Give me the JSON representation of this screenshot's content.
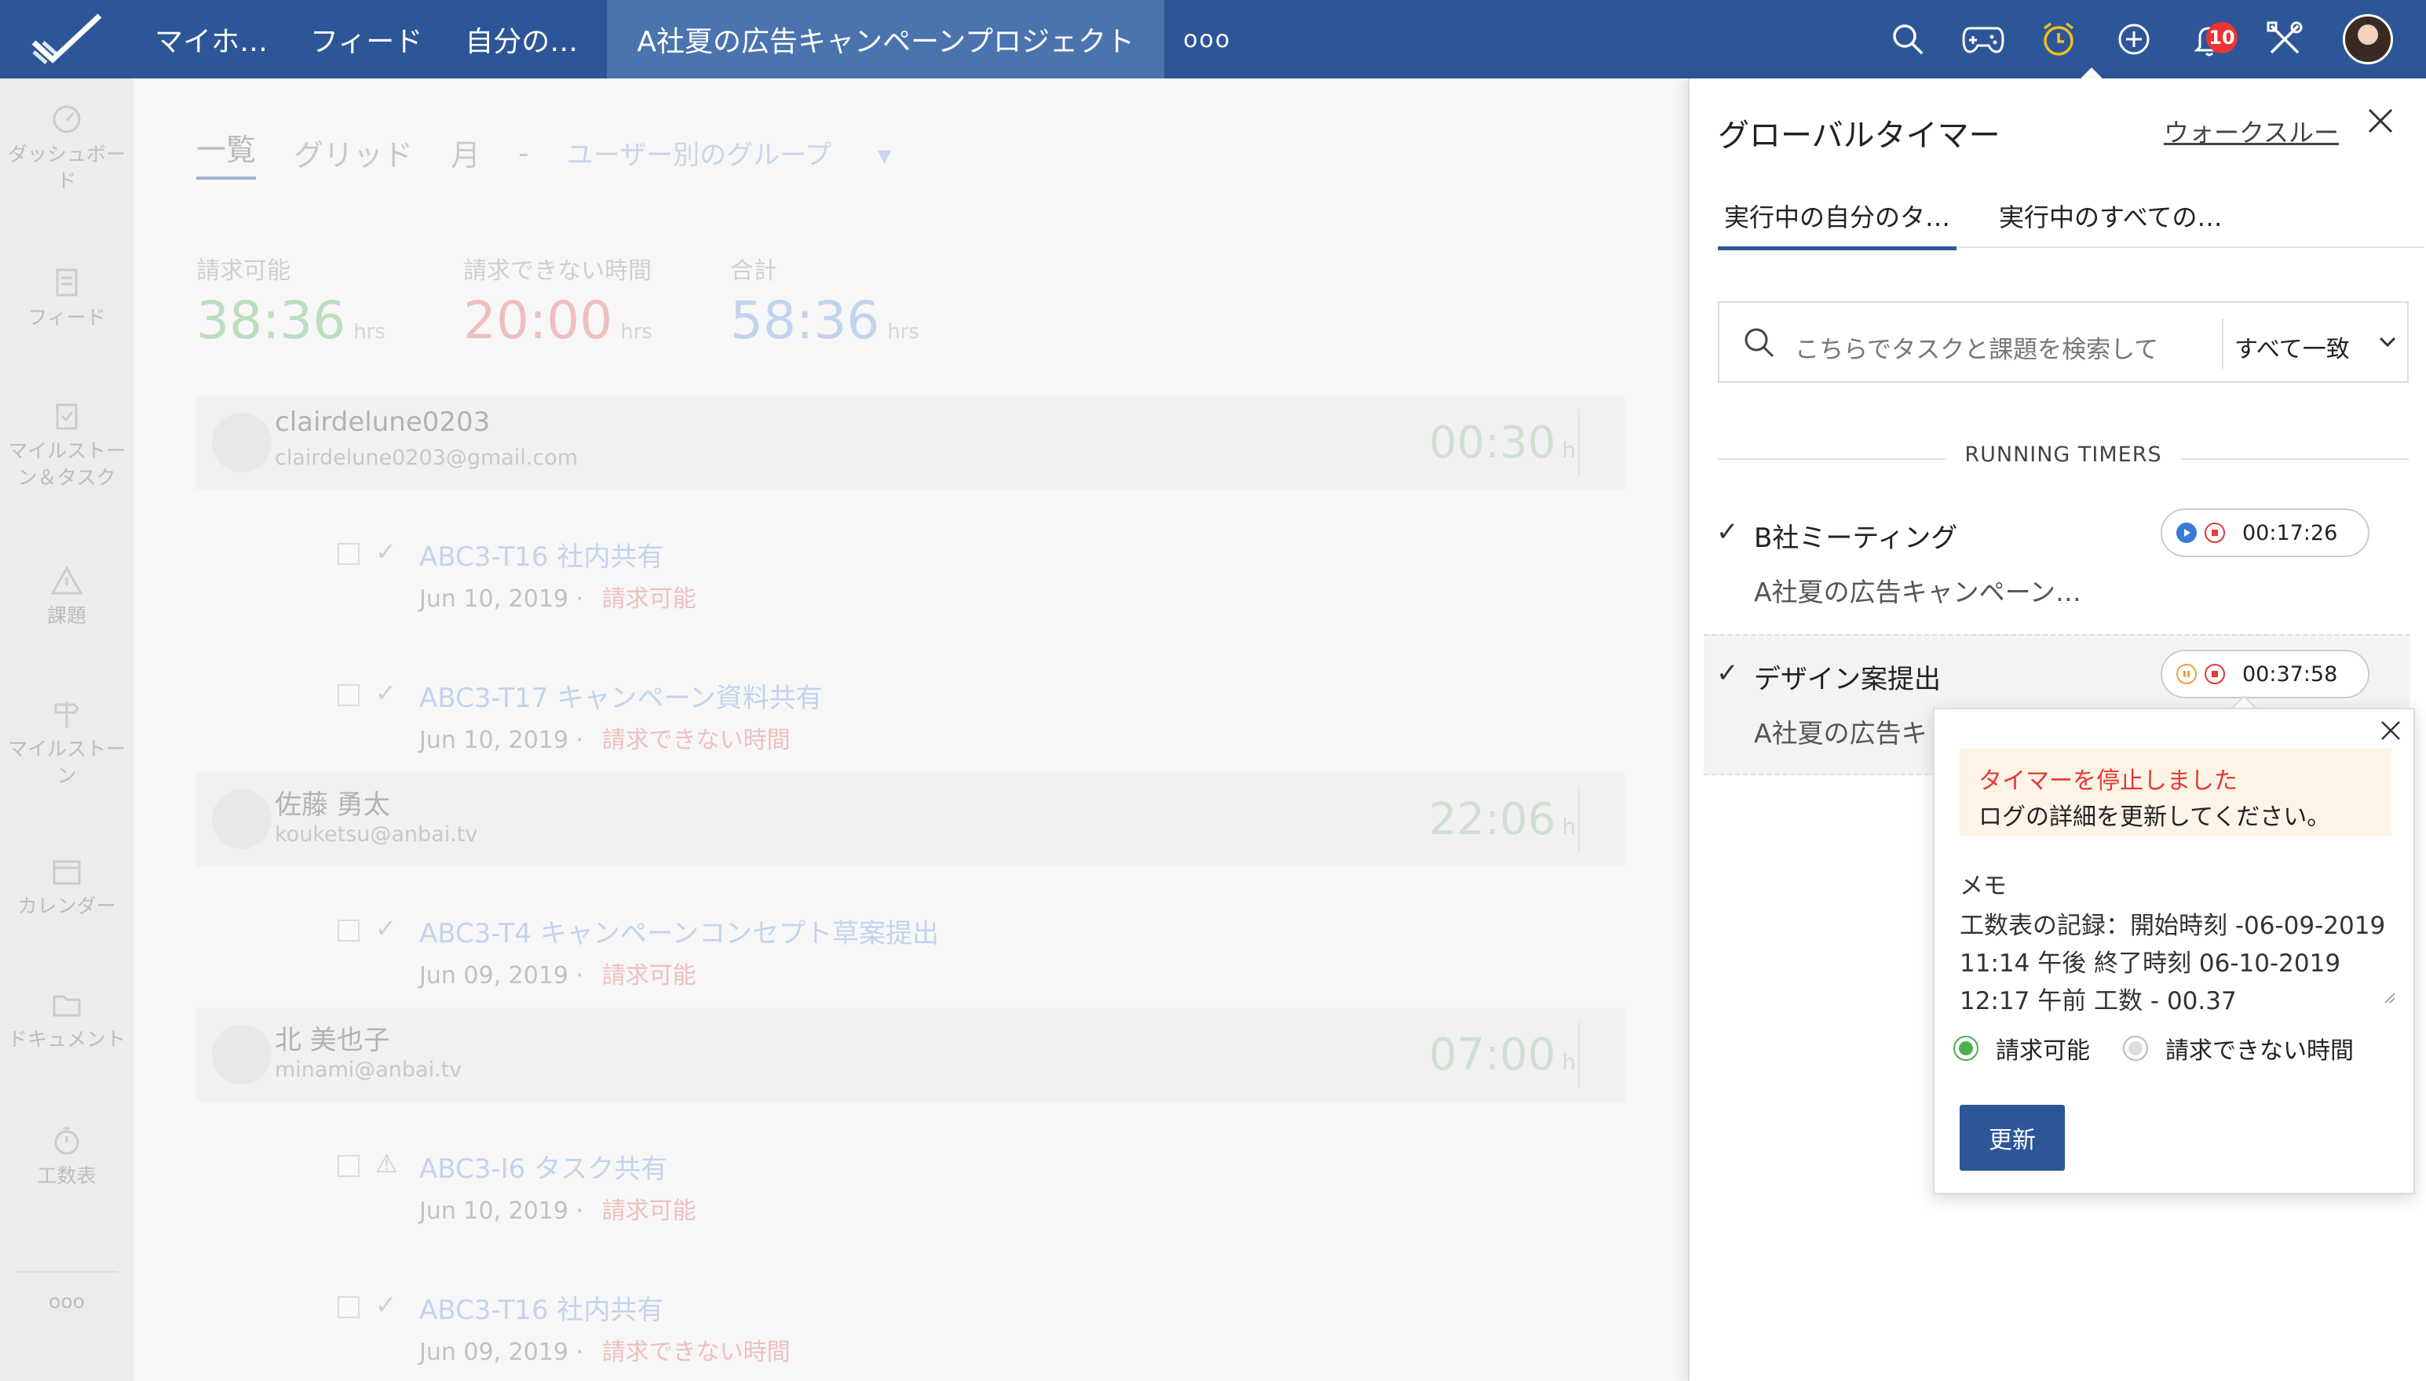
{
  "topbar": {
    "nav": [
      "マイホ…",
      "フィード",
      "自分の…"
    ],
    "active_project": "A社夏の広告キャンペーンプロジェクト",
    "more": "ooo",
    "notification_count": "10"
  },
  "sidebar": {
    "items": [
      {
        "label": "ダッシュボード",
        "icon": "gauge-icon"
      },
      {
        "label": "フィード",
        "icon": "feed-icon"
      },
      {
        "label": "マイルストーン＆タスク",
        "icon": "checklist-icon"
      },
      {
        "label": "課題",
        "icon": "warning-icon"
      },
      {
        "label": "マイルストーン",
        "icon": "signpost-icon"
      },
      {
        "label": "カレンダー",
        "icon": "calendar-icon"
      },
      {
        "label": "ドキュメント",
        "icon": "folder-icon"
      },
      {
        "label": "工数表",
        "icon": "stopwatch-icon"
      }
    ],
    "more": "ooo"
  },
  "main": {
    "views": [
      "一覧",
      "グリッド",
      "月",
      "-"
    ],
    "group": "ユーザー別のグループ",
    "stats": [
      {
        "label": "請求可能",
        "value": "38:36",
        "unit": "hrs",
        "color": "#6dbb74"
      },
      {
        "label": "請求できない時間",
        "value": "20:00",
        "unit": "hrs",
        "color": "#e57373"
      },
      {
        "label": "合計",
        "value": "58:36",
        "unit": "hrs",
        "color": "#7ea3df"
      }
    ],
    "users": [
      {
        "name": "clairdelune0203",
        "email": "clairdelune0203@gmail.com",
        "time": "00:30",
        "unit": "h"
      },
      {
        "name": "佐藤 勇太",
        "email": "kouketsu@anbai.tv",
        "time": "22:06",
        "unit": "h"
      },
      {
        "name": "北 美也子",
        "email": "minami@anbai.tv",
        "time": "07:00",
        "unit": "h"
      }
    ],
    "tasks": [
      {
        "name": "ABC3-T16 社内共有",
        "date": "Jun 10, 2019",
        "billing": "請求可能"
      },
      {
        "name": "ABC3-T17 キャンペーン資料共有",
        "date": "Jun 10, 2019",
        "billing": "請求できない時間"
      },
      {
        "name": "ABC3-T4 キャンペーンコンセプト草案提出",
        "date": "Jun 09, 2019",
        "billing": "請求可能"
      },
      {
        "name": "ABC3-I6 タスク共有",
        "date": "Jun 10, 2019",
        "billing": "請求可能"
      },
      {
        "name": "ABC3-T16 社内共有",
        "date": "Jun 09, 2019",
        "billing": "請求できない時間"
      }
    ]
  },
  "panel": {
    "title": "グローバルタイマー",
    "walkthrough": "ウォークスルー",
    "tabs": [
      "実行中の自分のタ…",
      "実行中のすべての…"
    ],
    "search_placeholder": "こちらでタスクと課題を検索して",
    "filter": "すべて一致",
    "section": "RUNNING TIMERS",
    "timers": [
      {
        "name": "B社ミーティング",
        "project": "A社夏の広告キャンペーン…",
        "time": "00:17:26",
        "state": "running"
      },
      {
        "name": "デザイン案提出",
        "project": "A社夏の広告キ",
        "time": "00:37:58",
        "state": "paused"
      }
    ]
  },
  "popup": {
    "alert_title": "タイマーを停止しました",
    "alert_msg": "ログの詳細を更新してください。",
    "memo_label": "メモ",
    "memo_text": "工数表の記録：開始時刻 -06-09-2019 11:14 午後 終了時刻 06-10-2019 12:17 午前 工数 - 00.37",
    "billable": "請求可能",
    "non_billable": "請求できない時間",
    "update": "更新"
  },
  "colors": {
    "brand": "#2c5697",
    "active_nav": "#4b73ae",
    "timer_orange": "#f0a040",
    "timer_red": "#e53935",
    "timer_blue": "#3a7bd5",
    "billable_green": "#4caf50"
  }
}
